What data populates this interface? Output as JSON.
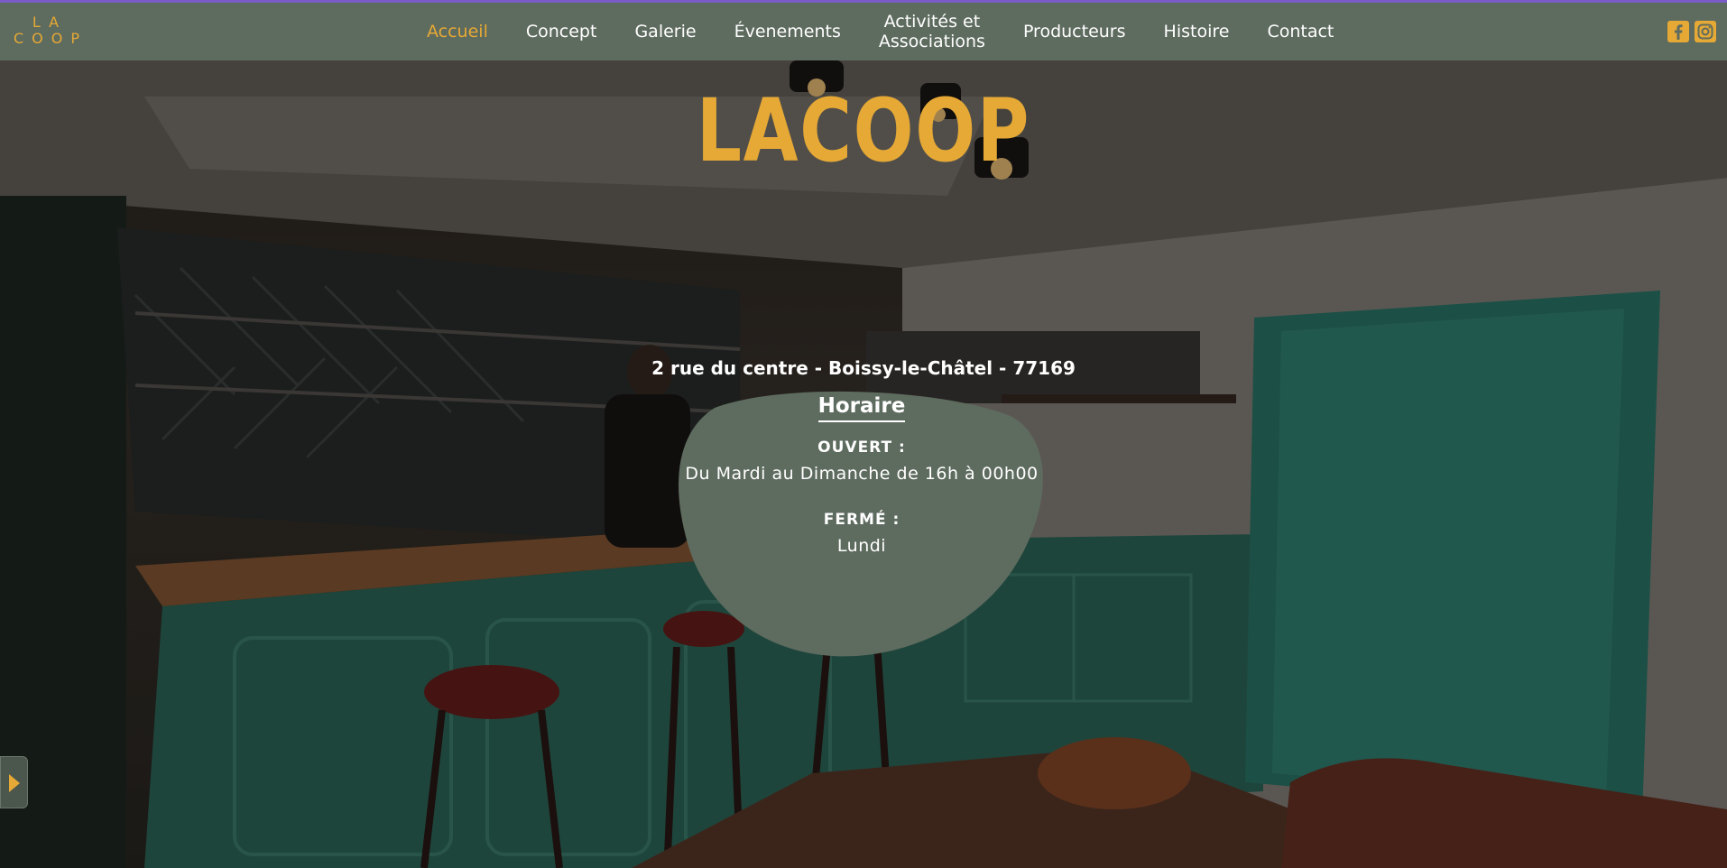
{
  "logo": {
    "line1": "LA",
    "line2": "COOP"
  },
  "nav": {
    "items": [
      {
        "label": "Accueil",
        "active": true
      },
      {
        "label": "Concept"
      },
      {
        "label": "Galerie"
      },
      {
        "label": "Évenements"
      },
      {
        "label_line1": "Activités et",
        "label_line2": "Associations"
      },
      {
        "label": "Producteurs"
      },
      {
        "label": "Histoire"
      },
      {
        "label": "Contact"
      }
    ],
    "social": [
      "facebook-icon",
      "instagram-icon"
    ]
  },
  "hero": {
    "title": "LACOOP",
    "address": "2 rue du centre - Boissy-le-Châtel - 77169",
    "hours": {
      "heading": "Horaire",
      "open_label": "OUVERT :",
      "open_value": "Du Mardi au Dimanche de 16h à 00h00",
      "closed_label": "FERMÉ :",
      "closed_value": "Lundi"
    }
  },
  "colors": {
    "accent": "#e6a935",
    "navbar": "#5e6b5f",
    "blob": "#5e6b5f",
    "top_line": "#7b5cc7"
  }
}
